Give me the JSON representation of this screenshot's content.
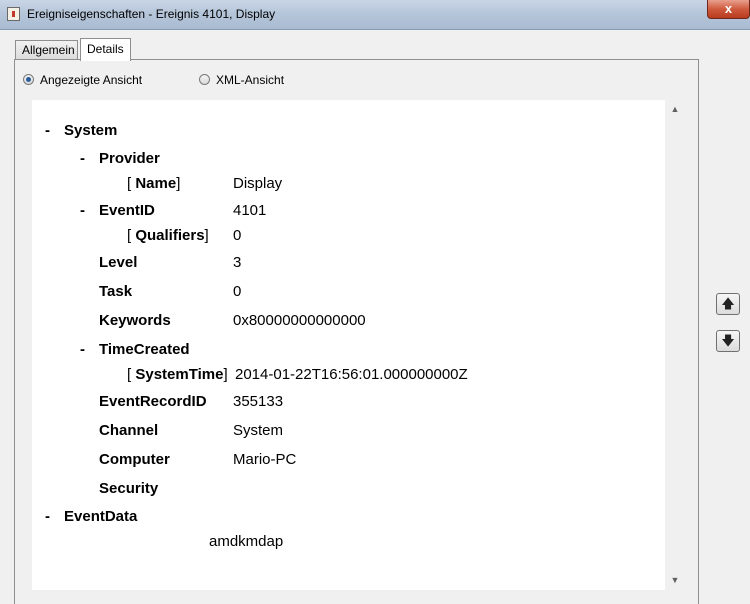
{
  "window": {
    "title": "Ereigniseigenschaften - Ereignis 4101, Display",
    "close_label": "x"
  },
  "tabs": [
    {
      "label": "Allgemein",
      "selected": false
    },
    {
      "label": "Details",
      "selected": true
    }
  ],
  "view_options": {
    "friendly": {
      "label": "Angezeigte Ansicht",
      "checked": true
    },
    "xml": {
      "label": "XML-Ansicht",
      "checked": false
    }
  },
  "tree": {
    "system": {
      "toggle": "-",
      "label": "System"
    },
    "provider": {
      "toggle": "-",
      "label": "Provider"
    },
    "provider_name": {
      "open": "[",
      "label": "Name",
      "close": "]",
      "value": "Display"
    },
    "event_id": {
      "toggle": "-",
      "label": "EventID",
      "value": "4101"
    },
    "qualifiers": {
      "open": "[",
      "label": "Qualifiers",
      "close": "]",
      "value": "0"
    },
    "level": {
      "label": "Level",
      "value": "3"
    },
    "task": {
      "label": "Task",
      "value": "0"
    },
    "keywords": {
      "label": "Keywords",
      "value": "0x80000000000000"
    },
    "time_created": {
      "toggle": "-",
      "label": "TimeCreated"
    },
    "system_time": {
      "open": "[",
      "label": "SystemTime",
      "close": "]",
      "value": "2014-01-22T16:56:01.000000000Z"
    },
    "event_record_id": {
      "label": "EventRecordID",
      "value": "355133"
    },
    "channel": {
      "label": "Channel",
      "value": "System"
    },
    "computer": {
      "label": "Computer",
      "value": "Mario-PC"
    },
    "security": {
      "label": "Security"
    },
    "event_data": {
      "toggle": "-",
      "label": "EventData",
      "value": "amdkmdap"
    }
  },
  "scrollbar": {
    "up_icon": "scroll-up-arrow",
    "down_icon": "scroll-down-arrow"
  },
  "navigation": {
    "up_icon": "arrow-up-icon",
    "down_icon": "arrow-down-icon"
  },
  "colors": {
    "radio_checked": "#2a5e9a",
    "close_button": "#cf5a3e",
    "title_bar": "#b6c6da"
  }
}
